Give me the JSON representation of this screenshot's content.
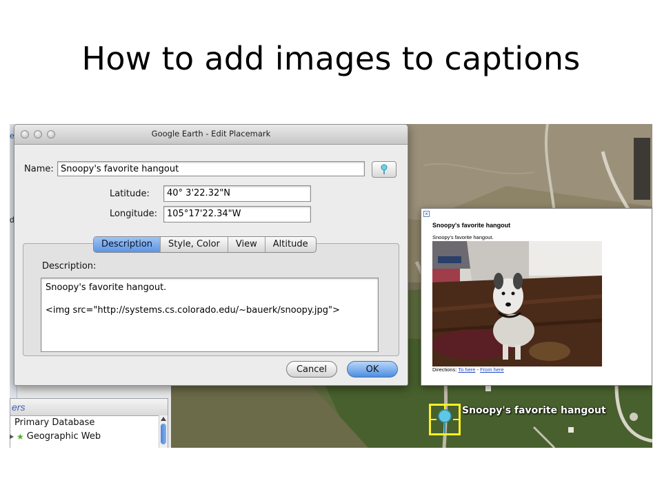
{
  "slide": {
    "title": "How to add images to captions"
  },
  "sidebar": {
    "fragments": [
      "es",
      "de"
    ],
    "layers": {
      "header": "ers",
      "items": [
        {
          "label": "Primary Database"
        },
        {
          "label": "Geographic Web"
        }
      ]
    }
  },
  "dialog": {
    "title": "Google Earth - Edit Placemark",
    "name_label": "Name:",
    "name_value": "Snoopy's favorite hangout",
    "latitude_label": "Latitude:",
    "latitude_value": "40° 3'22.32\"N",
    "longitude_label": "Longitude:",
    "longitude_value": "105°17'22.34\"W",
    "tabs": [
      {
        "label": "Description",
        "active": true
      },
      {
        "label": "Style, Color",
        "active": false
      },
      {
        "label": "View",
        "active": false
      },
      {
        "label": "Altitude",
        "active": false
      }
    ],
    "description_label": "Description:",
    "description_lines": [
      "Snoopy's favorite hangout.",
      "<img src=\"http://systems.cs.colorado.edu/~bauerk/snoopy.jpg\">"
    ],
    "cancel_label": "Cancel",
    "ok_label": "OK"
  },
  "balloon": {
    "title": "Snoopy's favorite hangout",
    "description": "Snoopy's favorite hangout.",
    "directions_label": "Directions:",
    "to_here": "To here",
    "separator": " - ",
    "from_here": "From here"
  },
  "map": {
    "placemark_label": "Snoopy's favorite hangout"
  },
  "colors": {
    "accent_blue": "#5d94e2",
    "placemark_highlight": "#ffef2a",
    "link_blue": "#1c47c4"
  }
}
